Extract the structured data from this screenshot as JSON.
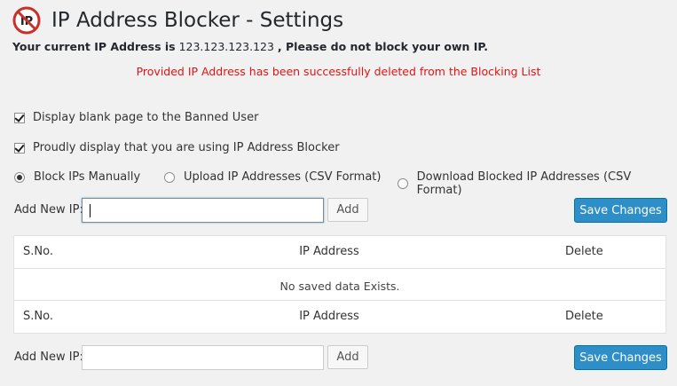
{
  "page": {
    "title": "IP Address Blocker - Settings",
    "ip_prefix": "Your current IP Address is",
    "ip_value": "123.123.123.123",
    "ip_suffix": ", Please do not block your own IP.",
    "notice": "Provided IP Address has been successfully deleted from the Blocking List"
  },
  "options": {
    "blank_page": {
      "label": "Display blank page to the Banned User",
      "checked": true
    },
    "proudly_display": {
      "label": "Proudly display that you are using IP Address Blocker",
      "checked": true
    }
  },
  "modes": [
    {
      "label": "Block IPs Manually",
      "selected": true
    },
    {
      "label": "Upload IP Addresses (CSV Format)",
      "selected": false
    },
    {
      "label": "Download Blocked IP Addresses (CSV Format)",
      "selected": false
    }
  ],
  "add_form": {
    "label": "Add New IP:",
    "top_value": "",
    "bottom_value": "",
    "add_button": "Add",
    "save_button": "Save Changes"
  },
  "table": {
    "headers": [
      "S.No.",
      "IP Address",
      "Delete"
    ],
    "empty_message": "No saved data Exists."
  },
  "colors": {
    "accent": "#2e8ec8",
    "notice": "#e01414"
  }
}
